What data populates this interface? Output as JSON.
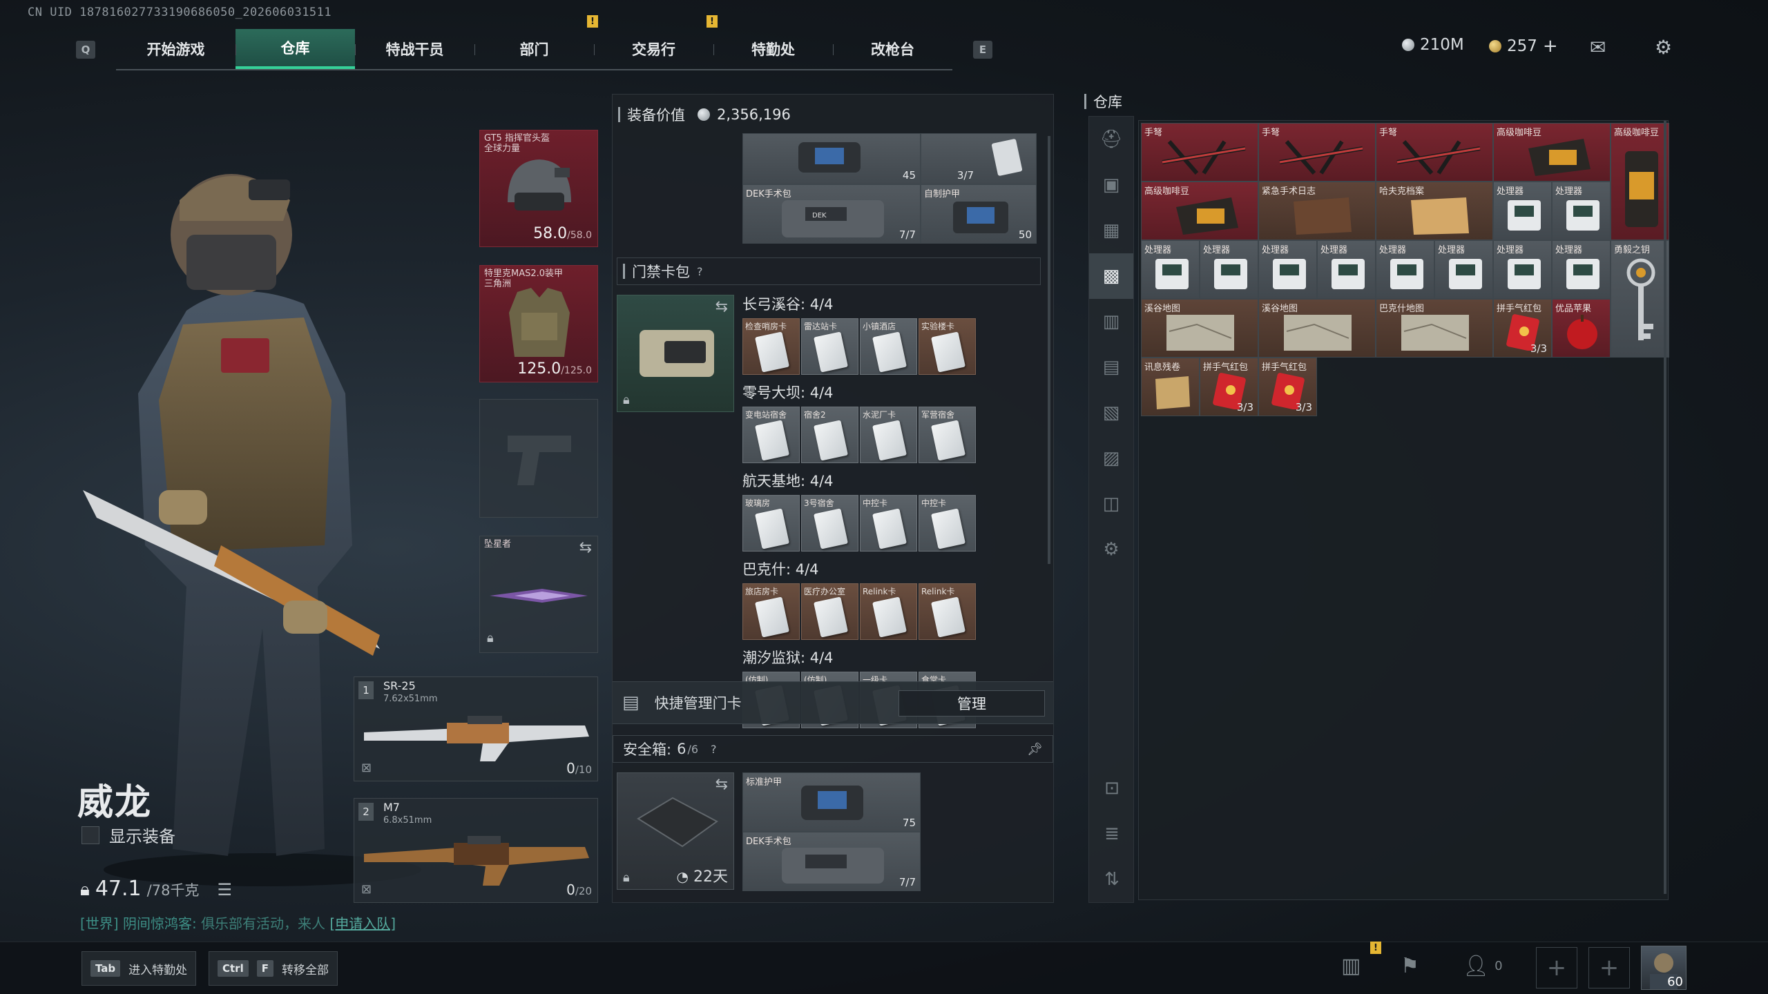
{
  "uid": "CN UID 187816027733190686050_202606031511",
  "nav": {
    "left_key": "Q",
    "right_key": "E",
    "tabs": [
      "开始游戏",
      "仓库",
      "特战干员",
      "部门",
      "交易行",
      "特勤处",
      "改枪台"
    ],
    "active_index": 1,
    "badge": "!"
  },
  "currency": {
    "silver": "210M",
    "gold": "257",
    "plus": "+"
  },
  "operator": {
    "name": "威龙",
    "show_equipment": "显示装备",
    "weight": "47.1",
    "weight_max": "/78千克",
    "chat_prefix": "[世界] 阴间惊鸿客:",
    "chat_text": "俱乐部有活动，来人",
    "chat_link": "[申请入队]"
  },
  "equipment": {
    "helmet": {
      "label": "GT5 指挥官头盔\n全球力量",
      "value": "58.0",
      "max": "/58.0"
    },
    "armor": {
      "label": "特里克MAS2.0装甲\n三角洲",
      "value": "125.0",
      "max": "/125.0"
    },
    "melee": {
      "label": "坠星者"
    },
    "weapon1": {
      "num": "1",
      "name": "SR-25",
      "caliber": "7.62x51mm",
      "ammo": "0",
      "ammo_max": "/10"
    },
    "weapon2": {
      "num": "2",
      "name": "M7",
      "caliber": "6.8x51mm",
      "ammo": "0",
      "ammo_max": "/20"
    }
  },
  "center": {
    "equip_value_label": "装备价值",
    "equip_value": "2,356,196",
    "top_items": [
      {
        "name": "",
        "count": "45"
      },
      {
        "name": "",
        "count": "3/7"
      },
      {
        "name": "DEK手术包",
        "count": "7/7"
      },
      {
        "name": "自制护甲",
        "count": "50"
      }
    ],
    "keycard_title": "门禁卡包",
    "help": "?",
    "regions": [
      {
        "title": "长弓溪谷: 4/4",
        "cards": [
          "检查哨房卡",
          "雷达站卡",
          "小镇酒店",
          "实验楼卡"
        ]
      },
      {
        "title": "零号大坝: 4/4",
        "cards": [
          "变电站宿舍",
          "宿舍2",
          "水泥厂卡",
          "军营宿舍"
        ]
      },
      {
        "title": "航天基地: 4/4",
        "cards": [
          "玻璃房",
          "3号宿舍",
          "中控卡",
          "中控卡"
        ]
      },
      {
        "title": "巴克什: 4/4",
        "cards": [
          "旅店房卡",
          "医疗办公室",
          "Relink卡",
          "Relink卡"
        ]
      },
      {
        "title": "潮汐监狱: 4/4",
        "cards": [
          "(仿制)",
          "(仿制)",
          "一级卡",
          "食堂卡"
        ]
      }
    ],
    "quick_manage": "快捷管理门卡",
    "manage_btn": "管理",
    "safe_label": "安全箱:",
    "safe_count": "6",
    "safe_max": "/6",
    "safe_days": "22天",
    "safe_items": [
      {
        "name": "标准护甲",
        "count": "75"
      },
      {
        "name": "DEK手术包",
        "count": "7/7"
      }
    ]
  },
  "warehouse": {
    "title": "仓库",
    "items": [
      {
        "name": "手弩",
        "count": ""
      },
      {
        "name": "手弩",
        "count": ""
      },
      {
        "name": "手弩",
        "count": ""
      },
      {
        "name": "高级咖啡豆",
        "count": ""
      },
      {
        "name": "高级咖啡豆",
        "count": ""
      },
      {
        "name": "高级咖啡豆",
        "count": ""
      },
      {
        "name": "紧急手术日志",
        "count": ""
      },
      {
        "name": "哈夫克档案",
        "count": ""
      },
      {
        "name": "处理器",
        "count": ""
      },
      {
        "name": "处理器",
        "count": ""
      },
      {
        "name": "处理器",
        "count": ""
      },
      {
        "name": "处理器",
        "count": ""
      },
      {
        "name": "处理器",
        "count": ""
      },
      {
        "name": "处理器",
        "count": ""
      },
      {
        "name": "处理器",
        "count": ""
      },
      {
        "name": "处理器",
        "count": ""
      },
      {
        "name": "处理器",
        "count": ""
      },
      {
        "name": "处理器",
        "count": ""
      },
      {
        "name": "勇毅之钥",
        "count": ""
      },
      {
        "name": "溪谷地图",
        "count": ""
      },
      {
        "name": "溪谷地图",
        "count": ""
      },
      {
        "name": "巴克什地图",
        "count": ""
      },
      {
        "name": "拼手气红包",
        "count": "3/3"
      },
      {
        "name": "优品苹果",
        "count": ""
      },
      {
        "name": "讯息残卷",
        "count": ""
      },
      {
        "name": "拼手气红包",
        "count": "3/3"
      },
      {
        "name": "拼手气红包",
        "count": "3/3"
      }
    ]
  },
  "bottom": {
    "tab_key": "Tab",
    "tab_label": "进入特勤处",
    "ctrl_key": "Ctrl",
    "f_key": "F",
    "transfer_label": "转移全部",
    "friends": "0",
    "level": "60"
  }
}
